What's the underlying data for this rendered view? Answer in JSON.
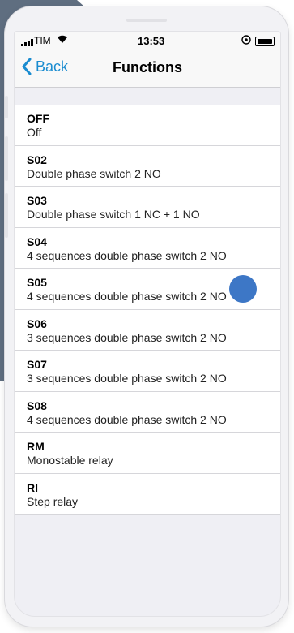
{
  "status": {
    "carrier": "TIM",
    "time": "13:53"
  },
  "nav": {
    "back_label": "Back",
    "title": "Functions"
  },
  "functions": [
    {
      "code": "OFF",
      "description": "Off"
    },
    {
      "code": "S02",
      "description": "Double phase switch 2 NO"
    },
    {
      "code": "S03",
      "description": "Double phase switch 1 NC + 1 NO"
    },
    {
      "code": "S04",
      "description": "4 sequences double phase switch 2 NO"
    },
    {
      "code": "S05",
      "description": "4 sequences double phase switch 2 NO"
    },
    {
      "code": "S06",
      "description": "3 sequences double phase switch 2 NO"
    },
    {
      "code": "S07",
      "description": "3 sequences double phase switch 2 NO"
    },
    {
      "code": "S08",
      "description": "4 sequences double phase switch 2 NO"
    },
    {
      "code": "RM",
      "description": "Monostable relay"
    },
    {
      "code": "RI",
      "description": "Step relay"
    }
  ],
  "colors": {
    "accent": "#1a8cd0",
    "touch_indicator": "#3d77c6",
    "background_shape": "#5f6e80"
  }
}
